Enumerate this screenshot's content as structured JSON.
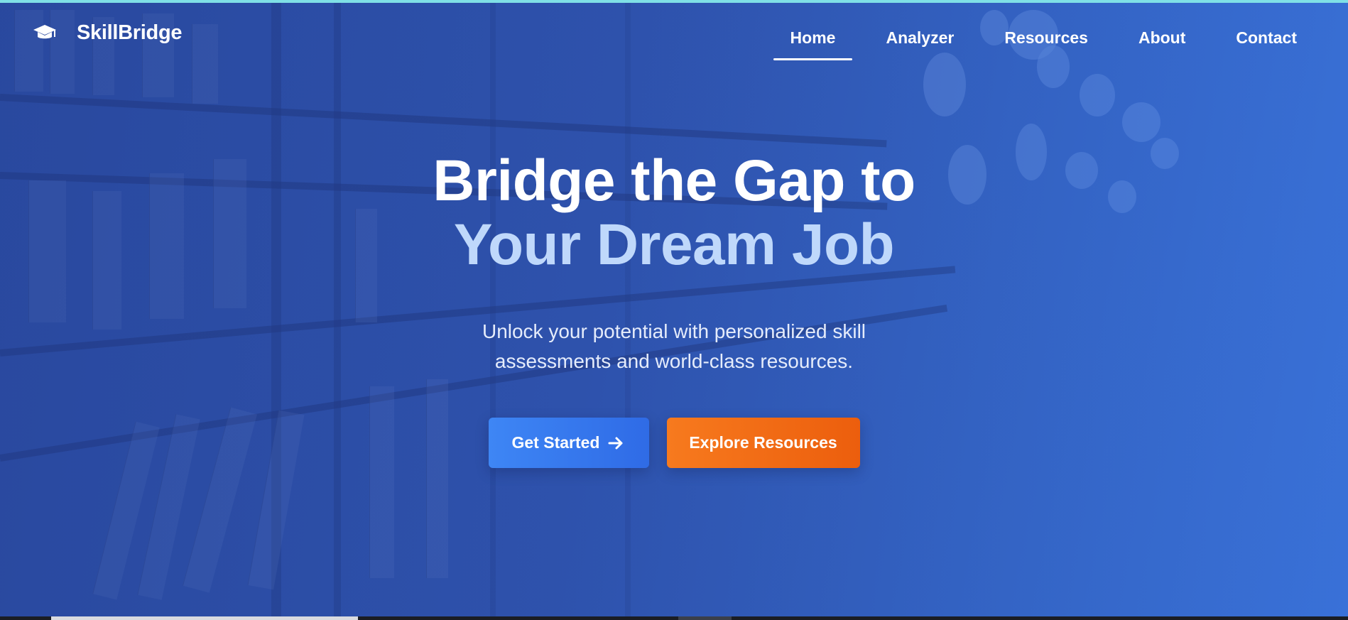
{
  "brand": {
    "name": "SkillBridge",
    "icon": "graduation-cap-icon"
  },
  "nav": {
    "items": [
      {
        "label": "Home",
        "active": true
      },
      {
        "label": "Analyzer",
        "active": false
      },
      {
        "label": "Resources",
        "active": false
      },
      {
        "label": "About",
        "active": false
      },
      {
        "label": "Contact",
        "active": false
      }
    ]
  },
  "hero": {
    "headline_line1": "Bridge the Gap to",
    "headline_line2": "Your Dream Job",
    "subtitle_line1": "Unlock your potential with personalized skill",
    "subtitle_line2": "assessments and world-class resources.",
    "primary_cta": "Get Started",
    "primary_cta_icon": "arrow-right-icon",
    "secondary_cta": "Explore Resources"
  },
  "colors": {
    "headline_primary": "#ffffff",
    "headline_accent": "#bfd8fb",
    "primary_button": "#3478f0",
    "secondary_button": "#f06a14",
    "top_strip": "#7fe0e6"
  }
}
